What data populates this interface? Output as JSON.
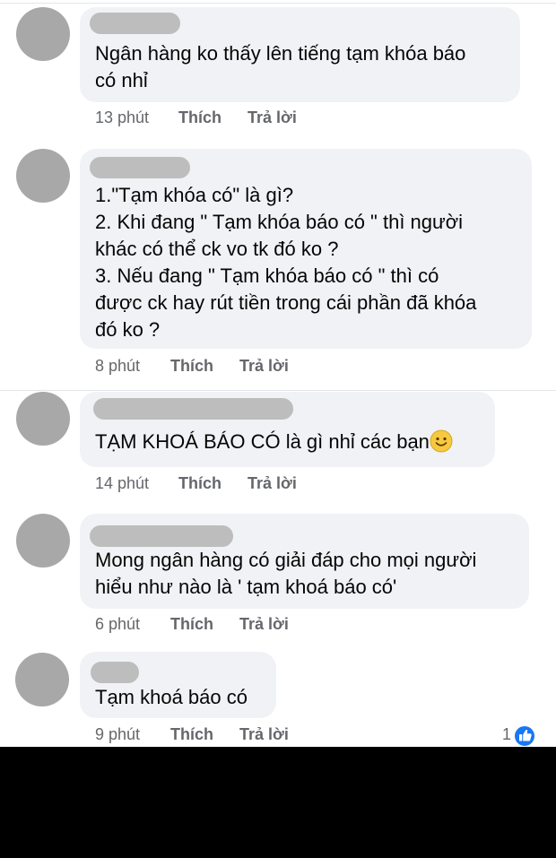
{
  "comments": [
    {
      "text": "Ngân hàng ko thấy lên tiếng tạm khóa báo\ncó nhỉ",
      "time": "13 phút",
      "like_label": "Thích",
      "reply_label": "Trả lời"
    },
    {
      "text": "1.\"Tạm khóa có\" là gì?\n2. Khi đang \" Tạm khóa báo có \" thì người\nkhác có thể ck vo tk đó ko ?\n3. Nếu đang \" Tạm khóa báo có \" thì có\nđược ck hay rút tiền trong cái phần đã khóa\nđó ko ?",
      "time": "8 phút",
      "like_label": "Thích",
      "reply_label": "Trả lời"
    },
    {
      "text": "TẠM KHOÁ BÁO CÓ là gì nhỉ các bạn",
      "time": "14 phút",
      "like_label": "Thích",
      "reply_label": "Trả lời"
    },
    {
      "text": "Mong ngân hàng có giải đáp cho mọi người\nhiểu như nào là ' tạm khoá báo có'",
      "time": "6 phút",
      "like_label": "Thích",
      "reply_label": "Trả lời"
    },
    {
      "text": "Tạm khoá báo có",
      "time": "9 phút",
      "like_label": "Thích",
      "reply_label": "Trả lời",
      "reaction_count": "1"
    }
  ],
  "icons": {
    "emoji": "slightly-smiling-face",
    "reaction": "like-thumbs-up"
  },
  "colors": {
    "bubble": "#f0f2f5",
    "meta": "#65676b",
    "text": "#050505",
    "avatar": "#a8a8a8",
    "like": "#1877f2"
  }
}
